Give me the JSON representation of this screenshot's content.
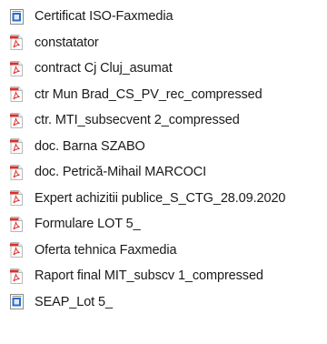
{
  "files": [
    {
      "name": "Certificat ISO-Faxmedia",
      "type": "word",
      "icon": "word-document-icon"
    },
    {
      "name": "constatator",
      "type": "pdf",
      "icon": "pdf-document-icon"
    },
    {
      "name": "contract Cj Cluj_asumat",
      "type": "pdf",
      "icon": "pdf-document-icon"
    },
    {
      "name": "ctr Mun Brad_CS_PV_rec_compressed",
      "type": "pdf",
      "icon": "pdf-document-icon"
    },
    {
      "name": "ctr. MTI_subsecvent 2_compressed",
      "type": "pdf",
      "icon": "pdf-document-icon"
    },
    {
      "name": "doc. Barna SZABO",
      "type": "pdf",
      "icon": "pdf-document-icon"
    },
    {
      "name": "doc. Petrică-Mihail MARCOCI",
      "type": "pdf",
      "icon": "pdf-document-icon"
    },
    {
      "name": "Expert achizitii publice_S_CTG_28.09.2020",
      "type": "pdf",
      "icon": "pdf-document-icon"
    },
    {
      "name": "Formulare LOT 5_",
      "type": "pdf",
      "icon": "pdf-document-icon"
    },
    {
      "name": "Oferta tehnica Faxmedia",
      "type": "pdf",
      "icon": "pdf-document-icon"
    },
    {
      "name": "Raport final MIT_subscv 1_compressed",
      "type": "pdf",
      "icon": "pdf-document-icon"
    },
    {
      "name": "SEAP_Lot 5_",
      "type": "word",
      "icon": "word-document-icon"
    }
  ],
  "colors": {
    "pdf_accent": "#d9302c",
    "word_accent": "#2b6cc4",
    "text": "#1a1a1a"
  }
}
